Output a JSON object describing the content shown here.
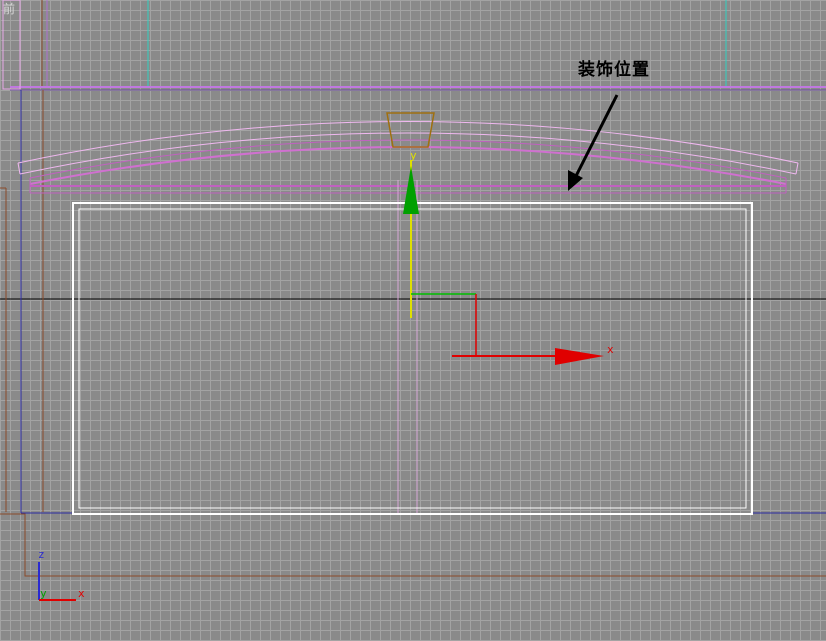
{
  "viewport": {
    "label": "前"
  },
  "annotation": {
    "text": "装饰位置"
  },
  "gizmo": {
    "x_label": "x",
    "y_label": "y"
  },
  "axis_tripod": {
    "x_label": "x",
    "y_label": "y",
    "z_label": "z"
  },
  "colors": {
    "background": "#8a8a8a",
    "grid": "#a3a3a3",
    "selection_box": "#ffffff",
    "arc_object": "#e88ce8",
    "gizmo_x": "#e00000",
    "gizmo_y": "#00a000",
    "gizmo_y_axis": "#e0e000",
    "frame_brown": "#8b4a2a",
    "frame_blue": "#2a2aa0",
    "guide_cyan": "#30d0c0"
  }
}
